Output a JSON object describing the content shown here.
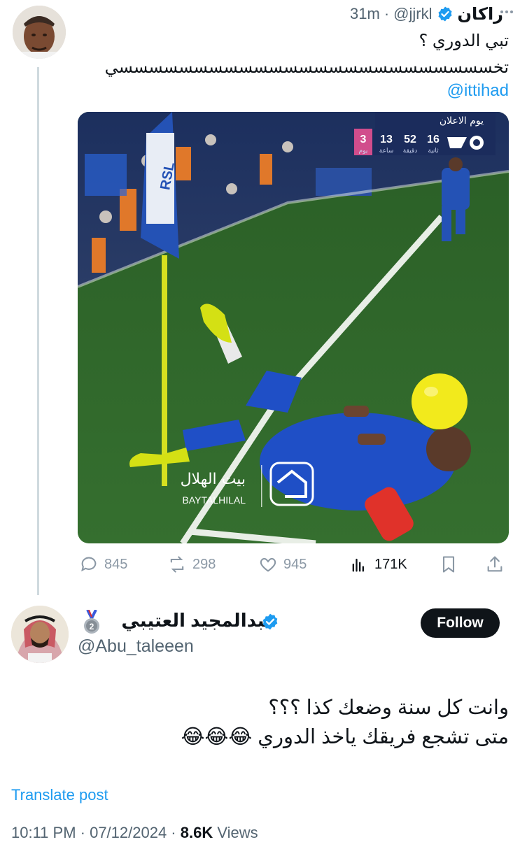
{
  "quoted_tweet": {
    "display_name": "راكان",
    "handle": "@jjrkl",
    "time": "31m",
    "separator": "·",
    "text_line1": "تبي الدوري ؟",
    "text_line2": "تخسسسسسسسسسسسسسسسسسسسسسسسسسي",
    "mention": "@ittihad",
    "media": {
      "scoreboard_title": "يوم الاعلان",
      "score_values": [
        "16",
        "52",
        "13",
        "3"
      ],
      "score_labels": [
        "ثانية",
        "دقيقة",
        "ساعة",
        "يوم"
      ],
      "flag_text": "RSL",
      "watermark_ar": "بيت الهلال",
      "watermark_en": "BAYTALHILAL"
    },
    "actions": {
      "replies": "845",
      "reposts": "298",
      "likes": "945",
      "views": "171K"
    },
    "icons": [
      "reply-icon",
      "repost-icon",
      "like-icon",
      "views-icon",
      "bookmark-icon",
      "share-icon",
      "verified-badge-icon",
      "more-icon"
    ]
  },
  "reply": {
    "display_name": "عبدالمجيد العتيبي",
    "handle": "@Abu_taleeen",
    "follow_label": "Follow",
    "text_line1": "وانت كل سنة وضعك كذا ؟؟؟",
    "text_line2": "متى تشجع فريقك ياخذ الدوري 😂😂😂",
    "translate_label": "Translate post",
    "timestamp": "10:11 PM · 07/12/2024 · ",
    "views_count": "8.6K",
    "views_label": " Views",
    "medal_number": "2"
  },
  "colors": {
    "accent": "#1d9bf0",
    "text": "#0f1419",
    "muted": "#536471",
    "pitch": "#2f6b2a",
    "hilal_blue": "#1e4fc2",
    "balloon": "#f2ea1c"
  }
}
